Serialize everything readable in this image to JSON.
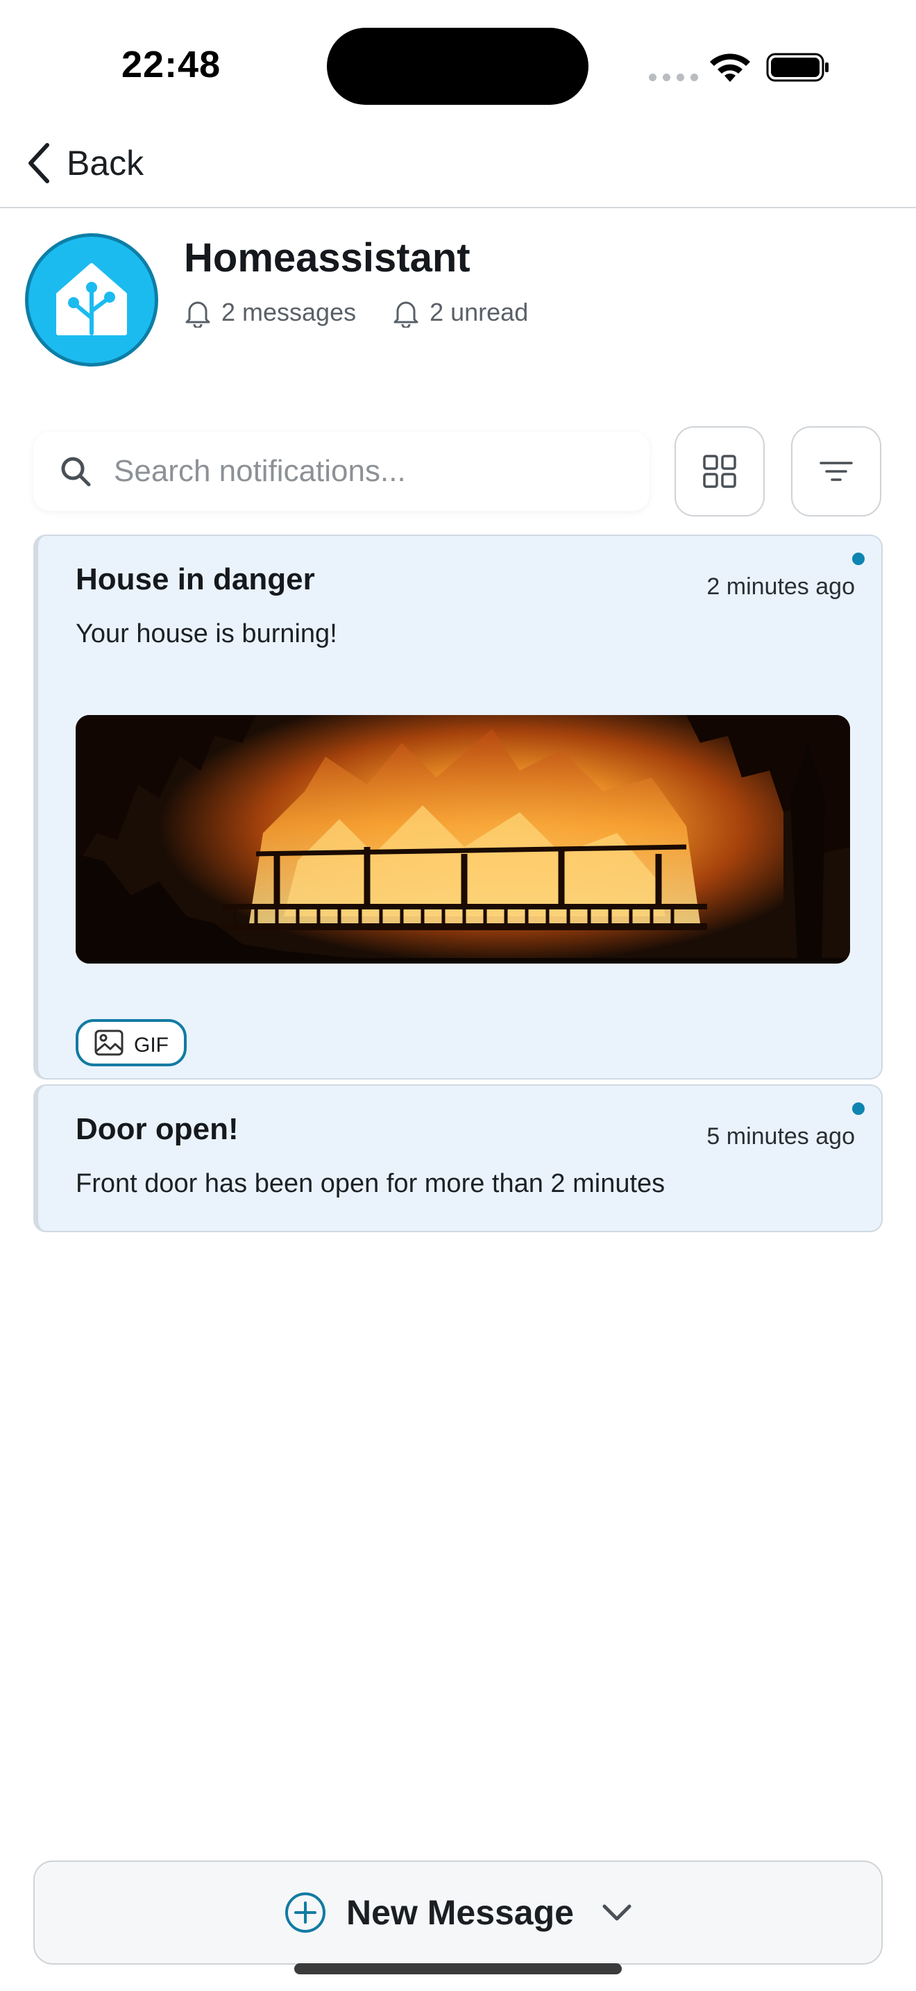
{
  "status_bar": {
    "time": "22:48"
  },
  "nav": {
    "back_label": "Back"
  },
  "header": {
    "title": "Homeassistant",
    "messages_count": "2 messages",
    "unread_count": "2 unread",
    "avatar_color": "#1bbbf0"
  },
  "search": {
    "placeholder": "Search notifications...",
    "value": ""
  },
  "notifications": [
    {
      "title": "House in danger",
      "time": "2 minutes ago",
      "body": "Your house is burning!",
      "attachment_label": "GIF",
      "unread": true
    },
    {
      "title": "Door open!",
      "time": "5 minutes ago",
      "body": "Front door has been open for more than 2 minutes",
      "unread": true
    }
  ],
  "footer": {
    "new_message_label": "New Message"
  },
  "colors": {
    "accent": "#0e84b0",
    "card_background": "#eaf3fc"
  }
}
